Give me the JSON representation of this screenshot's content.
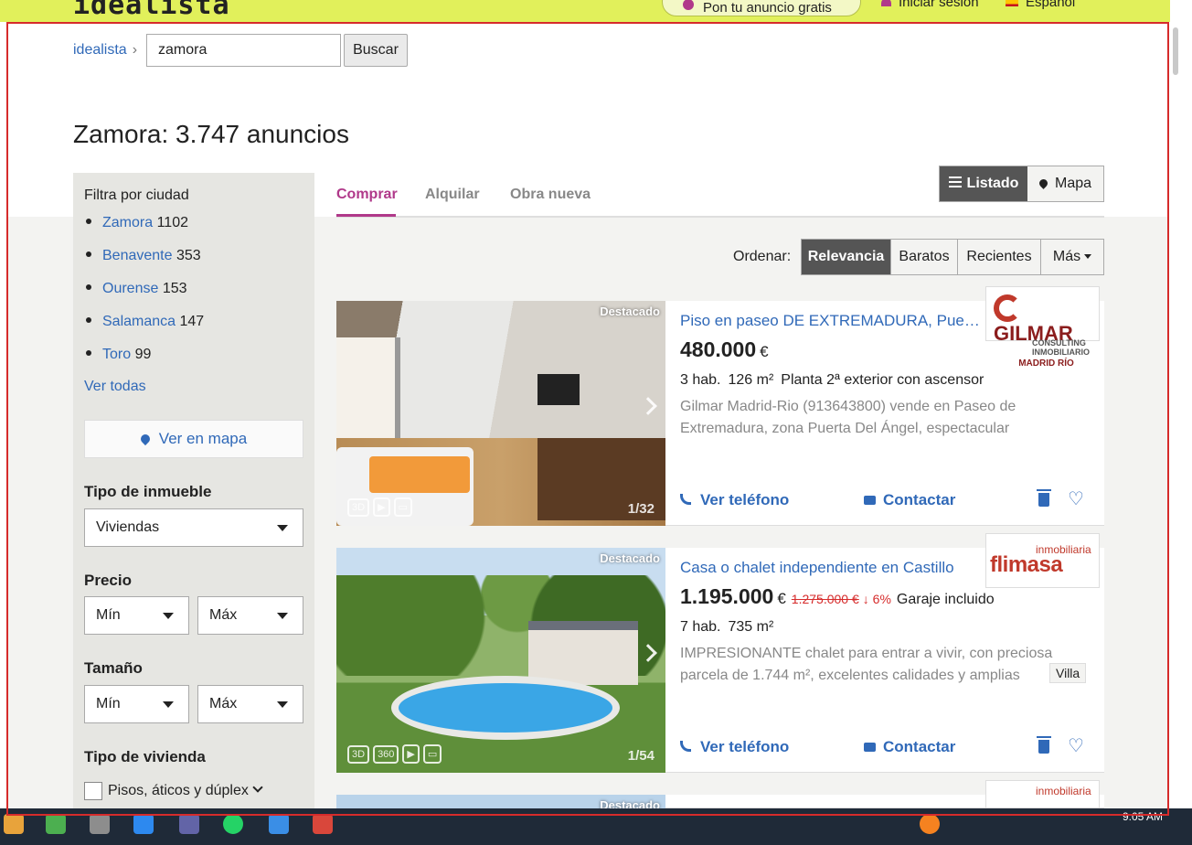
{
  "header": {
    "logo": "idealista",
    "publish_label": "Pon tu anuncio gratis",
    "login_label": "Iniciar sesión",
    "language_label": "Español"
  },
  "search": {
    "breadcrumb_home": "idealista",
    "query": "zamora",
    "button_label": "Buscar"
  },
  "page_title": "Zamora: 3.747 anuncios",
  "sidebar": {
    "filter_city_title": "Filtra por ciudad",
    "cities": [
      {
        "name": "Zamora",
        "count": "1102"
      },
      {
        "name": "Benavente",
        "count": "353"
      },
      {
        "name": "Ourense",
        "count": "153"
      },
      {
        "name": "Salamanca",
        "count": "147"
      },
      {
        "name": "Toro",
        "count": "99"
      }
    ],
    "see_all": "Ver todas",
    "map_button": "Ver en mapa",
    "property_type_label": "Tipo de inmueble",
    "property_type_value": "Viviendas",
    "price_label": "Precio",
    "price_min": "Mín",
    "price_max": "Máx",
    "size_label": "Tamaño",
    "size_min": "Mín",
    "size_max": "Máx",
    "housing_type_label": "Tipo de vivienda",
    "housing_option": "Pisos, áticos y dúplex"
  },
  "tabs": [
    "Comprar",
    "Alquilar",
    "Obra nueva"
  ],
  "view_toggle": {
    "list": "Listado",
    "map": "Mapa"
  },
  "sort": {
    "label": "Ordenar:",
    "options": [
      "Relevancia",
      "Baratos",
      "Recientes",
      "Más"
    ]
  },
  "listings": [
    {
      "badge": "Destacado",
      "photo_count": "1/32",
      "title": "Piso en paseo DE EXTREMADURA, Puerta del Ángel",
      "price": "480.000",
      "currency": "€",
      "details": [
        "3 hab.",
        "126 m²",
        "Planta 2ª exterior con ascensor"
      ],
      "description": "Gilmar Madrid-Rio (913643800) vende en Paseo de Extremadura, zona Puerta Del Ángel, espectacular vivienda",
      "phone_label": "Ver teléfono",
      "contact_label": "Contactar",
      "agency": {
        "name": "GILMAR",
        "subtitle": "CONSULTING INMOBILIARIO",
        "branch": "MADRID RÍO"
      }
    },
    {
      "badge": "Destacado",
      "photo_count": "1/54",
      "title": "Casa o chalet independiente en Castillo",
      "price": "1.195.000",
      "currency": "€",
      "old_price": "1.275.000 €",
      "drop": "↓ 6%",
      "extra": "Garaje incluido",
      "details": [
        "7 hab.",
        "735 m²"
      ],
      "description": "IMPRESIONANTE chalet para entrar a vivir, con preciosa parcela de 1.744 m², excelentes calidades y amplias estancias",
      "tag": "Villa",
      "phone_label": "Ver teléfono",
      "contact_label": "Contactar",
      "agency": {
        "name_small": "inmobiliaria",
        "name_big": "flimasa"
      }
    },
    {
      "badge": "Destacado",
      "agency": {
        "name_small": "inmobiliaria"
      }
    }
  ],
  "taskbar": {
    "time": "9:05 AM"
  }
}
